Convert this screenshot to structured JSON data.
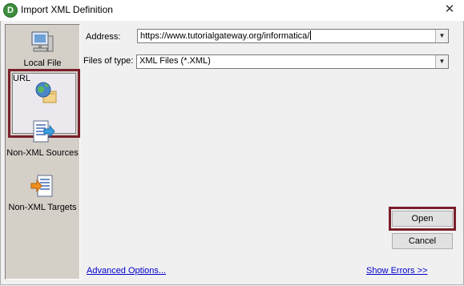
{
  "window": {
    "title": "Import XML Definition",
    "app_icon_letter": "D"
  },
  "sidebar": {
    "items": [
      {
        "label": "Local File",
        "icon": "computer-icon"
      },
      {
        "label": "URL",
        "icon": "web-globe-icon",
        "selected": true
      },
      {
        "label": "Non-XML Sources",
        "icon": "source-document-icon"
      },
      {
        "label": "Non-XML Targets",
        "icon": "target-document-icon"
      }
    ]
  },
  "form": {
    "address_label": "Address:",
    "address_value": "https://www.tutorialgateway.org/informatica/",
    "filetype_label": "Files of type:",
    "filetype_value": "XML Files (*.XML)"
  },
  "buttons": {
    "open": "Open",
    "cancel": "Cancel"
  },
  "links": {
    "advanced": "Advanced Options...",
    "errors": "Show Errors >>"
  },
  "colors": {
    "highlight_border": "#7a1f2b",
    "link": "#0000cc"
  }
}
